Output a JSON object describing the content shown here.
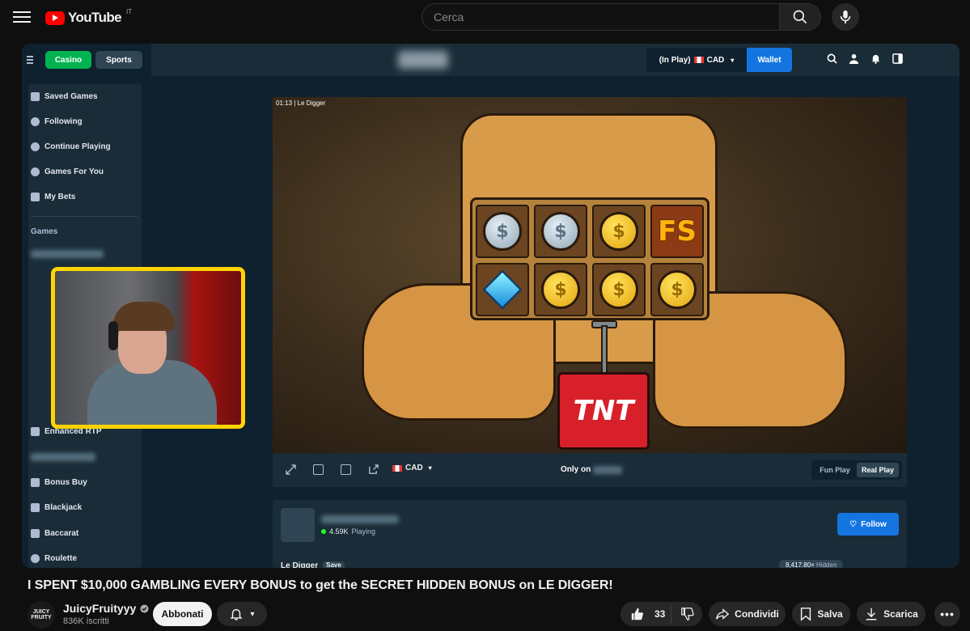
{
  "youtube": {
    "logo_text": "YouTube",
    "region": "IT",
    "search_placeholder": "Cerca"
  },
  "casino": {
    "tabs": [
      "Casino",
      "Sports"
    ],
    "sidebar": {
      "items": [
        "Saved Games",
        "Following",
        "Continue Playing",
        "Games For You",
        "My Bets"
      ],
      "games_heading": "Games",
      "game_items": [
        "Enhanced RTP",
        "Bonus Buy",
        "Blackjack",
        "Baccarat",
        "Roulette"
      ]
    },
    "topbar": {
      "in_play": "(In Play)",
      "currency": "CAD",
      "wallet": "Wallet"
    },
    "game": {
      "time": "01:13",
      "name_small": "Le Digger",
      "symbols_row1": [
        "silver-coin",
        "silver-coin",
        "gold-coin",
        "fs-scatter"
      ],
      "symbols_row2": [
        "diamond",
        "gold-coin",
        "gold-coin",
        "gold-coin"
      ],
      "coin_glyph": "$",
      "fs_text": "FS",
      "tnt_text": "TNT"
    },
    "game_bar": {
      "currency": "CAD",
      "only_on": "Only on",
      "fun_play": "Fun Play",
      "real_play": "Real Play"
    },
    "info": {
      "playing_count": "4.59K",
      "playing_label": "Playing",
      "follow": "Follow",
      "game_title": "Le Digger",
      "save": "Save",
      "stats": "8,417.80×",
      "hidden": "Hidden"
    }
  },
  "video": {
    "title": "I SPENT $10,000 GAMBLING EVERY BONUS to get the SECRET HIDDEN BONUS on LE DIGGER!",
    "channel": "JuicyFruityyy",
    "channel_avatar_text": "JUICY FRUITY",
    "subscribers": "836K iscritti",
    "subscribe": "Abbonati",
    "likes": "33",
    "share": "Condividi",
    "save": "Salva",
    "download": "Scarica"
  },
  "colors": {
    "youtube_red": "#ff0000",
    "casino_green": "#00b34f",
    "casino_blue": "#1475e1",
    "webcam_border": "#ffd400"
  }
}
